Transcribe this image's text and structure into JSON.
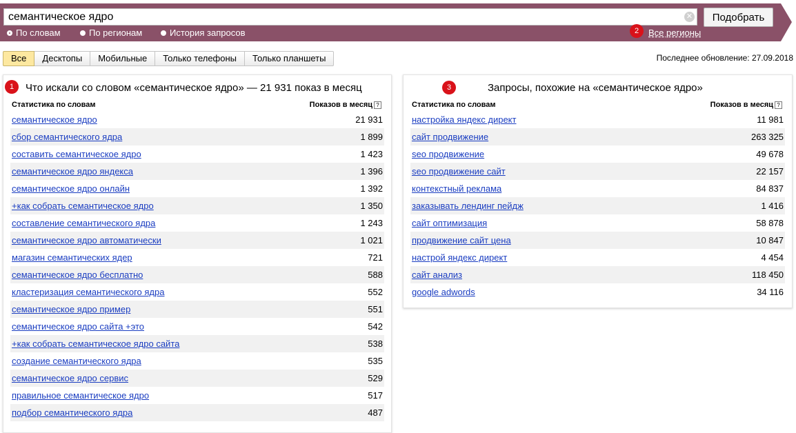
{
  "search": {
    "value": "семантическое ядро",
    "submit_label": "Подобрать",
    "modes": [
      {
        "label": "По словам",
        "checked": true
      },
      {
        "label": "По регионам",
        "checked": false
      },
      {
        "label": "История запросов",
        "checked": false
      }
    ],
    "regions_label": "Все регионы"
  },
  "badges": [
    "1",
    "2",
    "3"
  ],
  "device_tabs": [
    {
      "label": "Все",
      "active": true
    },
    {
      "label": "Десктопы",
      "active": false
    },
    {
      "label": "Мобильные",
      "active": false
    },
    {
      "label": "Только телефоны",
      "active": false
    },
    {
      "label": "Только планшеты",
      "active": false
    }
  ],
  "last_update": "Последнее обновление: 27.09.2018",
  "left_panel": {
    "title": "Что искали со словом «семантическое ядро» — 21 931 показ в месяц",
    "col_phrase": "Статистика по словам",
    "col_count": "Показов в месяц",
    "rows": [
      {
        "phrase": "семантическое ядро",
        "count": "21 931"
      },
      {
        "phrase": "сбор семантического ядра",
        "count": "1 899"
      },
      {
        "phrase": "составить семантическое ядро",
        "count": "1 423"
      },
      {
        "phrase": "семантическое ядро яндекса",
        "count": "1 396"
      },
      {
        "phrase": "семантическое ядро онлайн",
        "count": "1 392"
      },
      {
        "phrase": "+как собрать семантическое ядро",
        "count": "1 350"
      },
      {
        "phrase": "составление семантического ядра",
        "count": "1 243"
      },
      {
        "phrase": "семантическое ядро автоматически",
        "count": "1 021"
      },
      {
        "phrase": "магазин семантических ядер",
        "count": "721"
      },
      {
        "phrase": "семантическое ядро бесплатно",
        "count": "588"
      },
      {
        "phrase": "кластеризация семантического ядра",
        "count": "552"
      },
      {
        "phrase": "семантическое ядро пример",
        "count": "551"
      },
      {
        "phrase": "семантическое ядро сайта +это",
        "count": "542"
      },
      {
        "phrase": "+как собрать семантическое ядро сайта",
        "count": "538"
      },
      {
        "phrase": "создание семантического ядра",
        "count": "535"
      },
      {
        "phrase": "семантическое ядро сервис",
        "count": "529"
      },
      {
        "phrase": "правильное семантическое ядро",
        "count": "517"
      },
      {
        "phrase": "подбор семантического ядра",
        "count": "487"
      }
    ]
  },
  "right_panel": {
    "title": "Запросы, похожие на «семантическое ядро»",
    "col_phrase": "Статистика по словам",
    "col_count": "Показов в месяц",
    "rows": [
      {
        "phrase": "настройка яндекс директ",
        "count": "11 981"
      },
      {
        "phrase": "сайт продвижение",
        "count": "263 325"
      },
      {
        "phrase": "seo продвижение",
        "count": "49 678"
      },
      {
        "phrase": "seo продвижение сайт",
        "count": "22 157"
      },
      {
        "phrase": "контекстный реклама",
        "count": "84 837"
      },
      {
        "phrase": "заказывать лендинг пейдж",
        "count": "1 416"
      },
      {
        "phrase": "сайт оптимизация",
        "count": "58 878"
      },
      {
        "phrase": "продвижение сайт цена",
        "count": "10 847"
      },
      {
        "phrase": "настрой яндекс директ",
        "count": "4 454"
      },
      {
        "phrase": "сайт анализ",
        "count": "118 450"
      },
      {
        "phrase": "google adwords",
        "count": "34 116"
      }
    ]
  },
  "icons": {
    "clear": "clear-icon",
    "help": "help-icon"
  },
  "colors": {
    "band": "#8a5168",
    "link": "#1a3dc1",
    "badge": "#d9121a",
    "tab_active": "#fde8a0"
  }
}
